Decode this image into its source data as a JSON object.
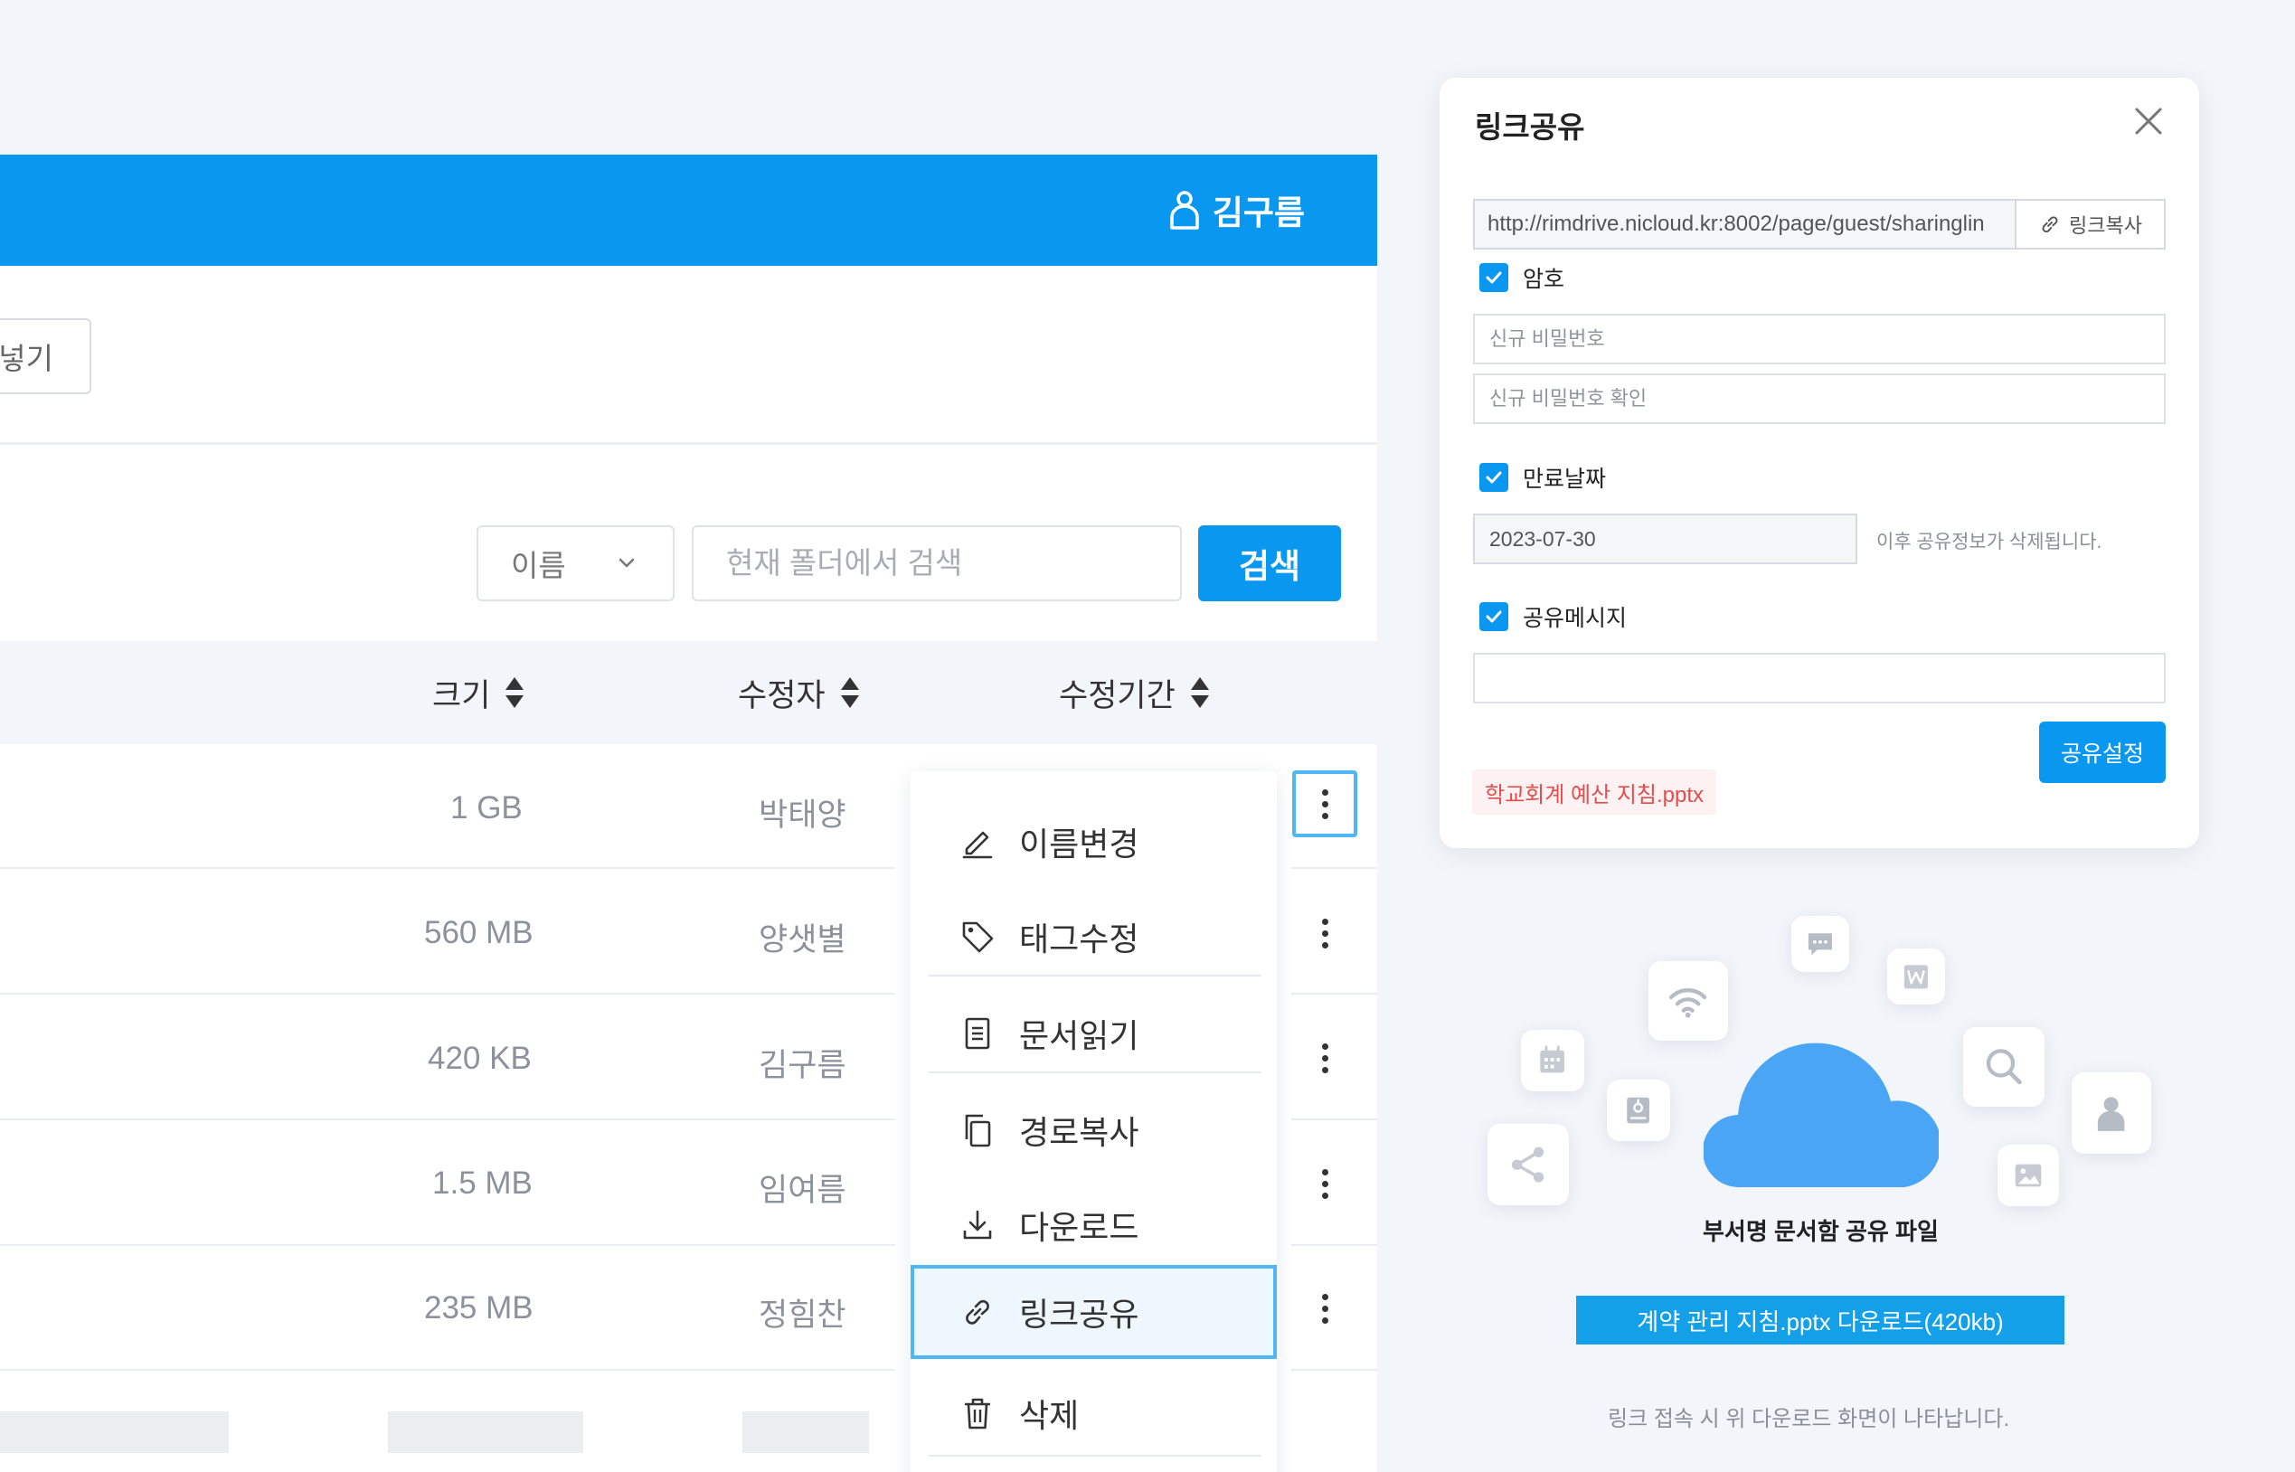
{
  "header": {
    "user_name": "김구름"
  },
  "toolbar": {
    "upload_label": "넣기"
  },
  "search": {
    "type_selected": "이름",
    "placeholder": "현재 폴더에서 검색",
    "button_label": "검색"
  },
  "table": {
    "columns": {
      "size": "크기",
      "modifier": "수정자",
      "modified_date": "수정기간"
    },
    "rows": [
      {
        "size": "1 GB",
        "modifier": "박태양"
      },
      {
        "size": "560 MB",
        "modifier": "양샛별"
      },
      {
        "size": "420 KB",
        "modifier": "김구름"
      },
      {
        "size": "1.5 MB",
        "modifier": "임여름"
      },
      {
        "size": "235 MB",
        "modifier": "정힘찬"
      }
    ]
  },
  "context_menu": {
    "items": [
      {
        "label": "이름변경",
        "icon": "pencil-icon"
      },
      {
        "label": "태그수정",
        "icon": "tag-icon"
      },
      {
        "label": "문서읽기",
        "icon": "document-icon"
      },
      {
        "label": "경로복사",
        "icon": "copy-icon"
      },
      {
        "label": "다운로드",
        "icon": "download-icon"
      },
      {
        "label": "링크공유",
        "icon": "link-icon",
        "selected": true
      },
      {
        "label": "삭제",
        "icon": "trash-icon"
      }
    ]
  },
  "dialog": {
    "title": "링크공유",
    "link_url": "http://rimdrive.nicloud.kr:8002/page/guest/sharinglin",
    "copy_label": "링크복사",
    "password": {
      "label": "암호",
      "checked": true,
      "new_placeholder": "신규 비밀번호",
      "confirm_placeholder": "신규 비밀번호 확인"
    },
    "expiry": {
      "label": "만료날짜",
      "checked": true,
      "date": "2023-07-30",
      "note": "이후 공유정보가 삭제됩니다."
    },
    "message": {
      "label": "공유메시지",
      "checked": true,
      "value": ""
    },
    "share_button": "공유설정",
    "file_name": "학교회계 예산 지침.pptx"
  },
  "preview": {
    "folder_label": "부서명 문서함 공유 파일",
    "download_label": "계약 관리 지침.pptx 다운로드(420kb)",
    "note": "링크 접속 시 위 다운로드 화면이 나타납니다."
  },
  "colors": {
    "primary": "#0a97f0",
    "selection_border": "#4fb7f5",
    "file_chip_text": "#e24d4d",
    "cloud": "#4aa6f5"
  }
}
